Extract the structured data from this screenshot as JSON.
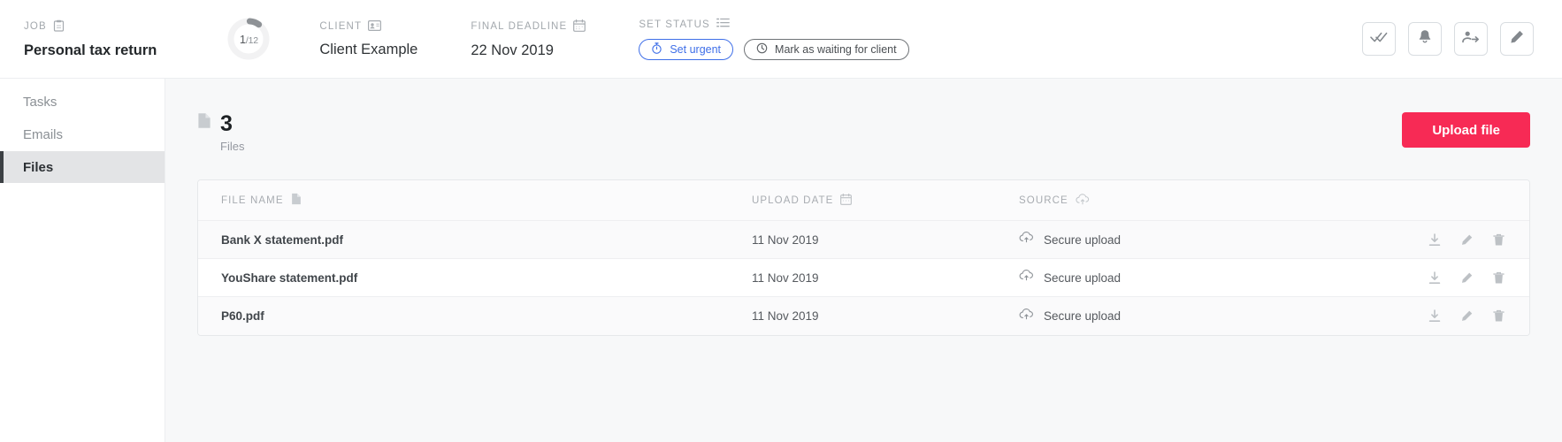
{
  "topbar": {
    "job": {
      "label": "JOB",
      "value": "Personal tax return",
      "icon": "clipboard-icon"
    },
    "progress": {
      "current": "1",
      "separator": "/",
      "total": "12",
      "percent": 8
    },
    "client": {
      "label": "CLIENT",
      "value": "Client Example",
      "icon": "contact-card-icon"
    },
    "deadline": {
      "label": "FINAL DEADLINE",
      "value": "22 Nov 2019",
      "icon": "calendar-icon"
    },
    "status": {
      "label": "SET STATUS",
      "icon": "list-icon",
      "chips": [
        {
          "label": "Set urgent",
          "icon": "stopwatch-icon",
          "color": "#3f6fe8"
        },
        {
          "label": "Mark as waiting for client",
          "icon": "clock-icon",
          "color": "#4a4e52"
        }
      ]
    },
    "actions": [
      {
        "name": "double-check-icon",
        "title": "Complete"
      },
      {
        "name": "bell-icon",
        "title": "Remind"
      },
      {
        "name": "person-share-icon",
        "title": "Assign"
      },
      {
        "name": "pencil-icon",
        "title": "Edit"
      }
    ]
  },
  "sidebar": {
    "items": [
      {
        "label": "Tasks",
        "active": false
      },
      {
        "label": "Emails",
        "active": false
      },
      {
        "label": "Files",
        "active": true
      }
    ]
  },
  "main": {
    "count": {
      "number": "3",
      "label": "Files",
      "icon": "file-icon"
    },
    "upload_button": {
      "label": "Upload file",
      "color": "#f72a55"
    },
    "table": {
      "columns": [
        {
          "label": "FILE NAME",
          "icon": "file-icon"
        },
        {
          "label": "UPLOAD DATE",
          "icon": "calendar-icon"
        },
        {
          "label": "SOURCE",
          "icon": "cloud-upload-icon"
        }
      ],
      "row_actions": [
        {
          "name": "download-icon"
        },
        {
          "name": "pencil-icon"
        },
        {
          "name": "trash-icon"
        }
      ],
      "rows": [
        {
          "name": "Bank X statement.pdf",
          "date": "11 Nov 2019",
          "source": "Secure upload",
          "highlight": true
        },
        {
          "name": "YouShare statement.pdf",
          "date": "11 Nov 2019",
          "source": "Secure upload",
          "highlight": false
        },
        {
          "name": "P60.pdf",
          "date": "11 Nov 2019",
          "source": "Secure upload",
          "highlight": true
        }
      ]
    }
  }
}
